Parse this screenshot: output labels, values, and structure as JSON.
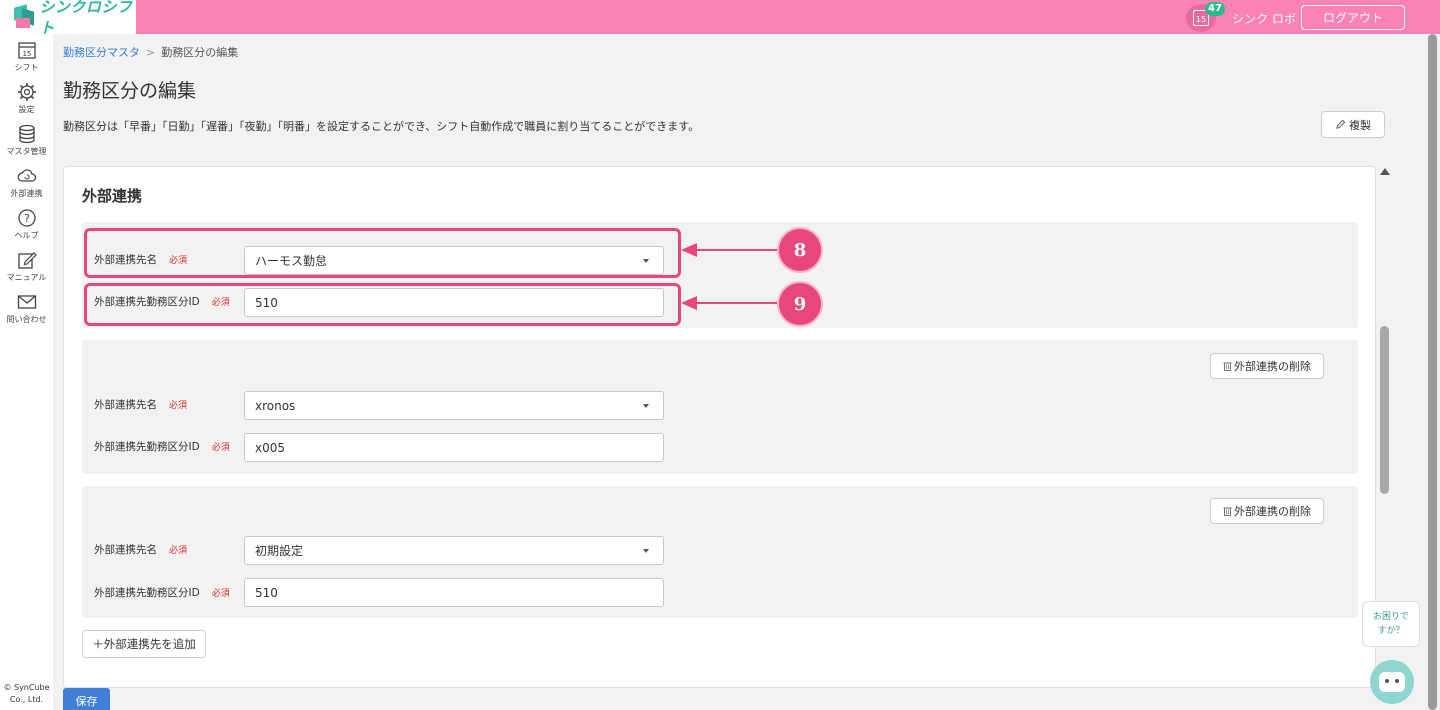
{
  "header": {
    "app_name": "シンクロシフト",
    "calendar_day": "15",
    "notification_count": "47",
    "user_name": "シンク ロボ",
    "logout_label": "ログアウト",
    "accent_color": "#fa82b4"
  },
  "sidebar": {
    "items": [
      {
        "label": "シフト",
        "icon": "calendar-icon"
      },
      {
        "label": "設定",
        "icon": "gear-icon"
      },
      {
        "label": "マスタ管理",
        "icon": "database-icon"
      },
      {
        "label": "外部連携",
        "icon": "cloud-icon"
      },
      {
        "label": "ヘルプ",
        "icon": "help-icon"
      },
      {
        "label": "マニュアル",
        "icon": "edit-icon"
      },
      {
        "label": "問い合わせ",
        "icon": "mail-icon"
      }
    ],
    "copyright_line1": "© SynCube",
    "copyright_line2": "Co., Ltd."
  },
  "breadcrumb": {
    "parent": "勤務区分マスタ",
    "separator": ">",
    "current": "勤務区分の編集"
  },
  "page": {
    "title": "勤務区分の編集",
    "description": "勤務区分は「早番」「日勤」「遅番」「夜勤」「明番」を設定することができ、シフト自動作成で職員に割り当てることができます。",
    "copy_label": "複製",
    "save_label": "保存"
  },
  "section": {
    "title": "外部連携",
    "name_label": "外部連携先名",
    "id_label": "外部連携先勤務区分ID",
    "required_label": "必須",
    "delete_label": "外部連携の削除",
    "add_label": "＋外部連携先を追加",
    "links": [
      {
        "name": "ハーモス勤怠",
        "id": "510"
      },
      {
        "name": "xronos",
        "id": "x005"
      },
      {
        "name": "初期設定",
        "id": "510"
      }
    ]
  },
  "annotations": {
    "marker_8": "8",
    "marker_9": "9",
    "color": "#e8477b"
  },
  "help": {
    "bubble_line1": "お困りで",
    "bubble_line2": "すか？"
  }
}
